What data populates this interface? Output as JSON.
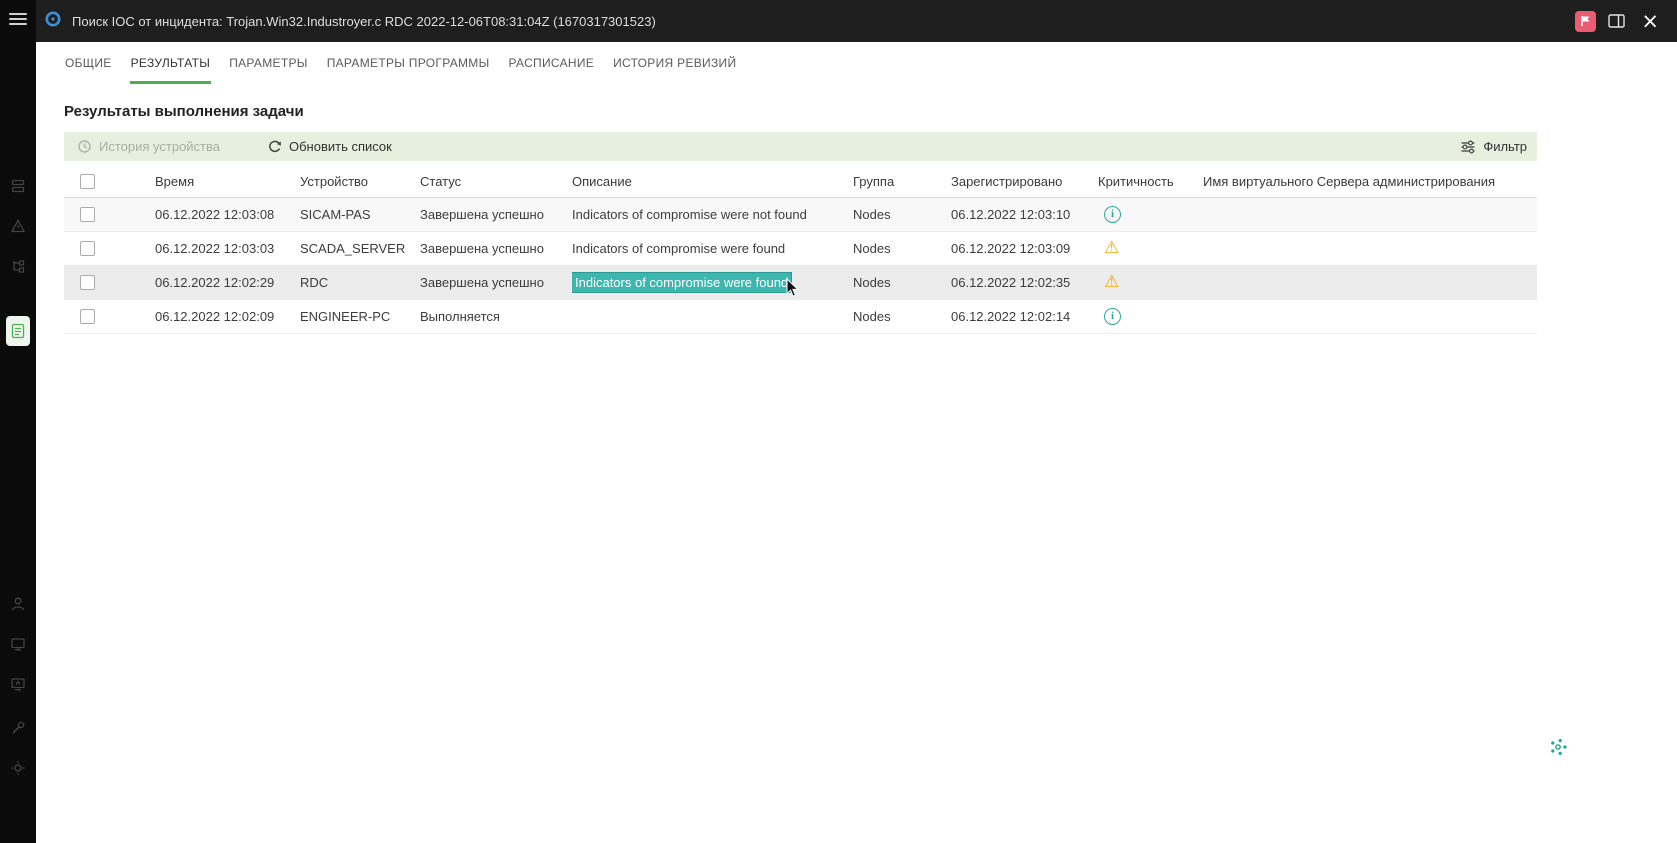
{
  "colors": {
    "accent_green": "#4caf50",
    "toolbar_band": "#e7f0de",
    "selection_teal": "#3db6af",
    "info_teal": "#2aa8a3",
    "warning_amber": "#f2a60a",
    "flag_pink": "#ea5c72",
    "titlebar_bg": "#1e1e1e",
    "sidebar_bg": "#0b0b0b"
  },
  "titlebar": {
    "title": "Поиск IOC от инцидента: Trojan.Win32.Industroyer.c RDC 2022-12-06T08:31:04Z (1670317301523)"
  },
  "tabs": [
    {
      "label": "ОБЩИЕ"
    },
    {
      "label": "РЕЗУЛЬТАТЫ"
    },
    {
      "label": "ПАРАМЕТРЫ"
    },
    {
      "label": "ПАРАМЕТРЫ ПРОГРАММЫ"
    },
    {
      "label": "РАСПИСАНИЕ"
    },
    {
      "label": "ИСТОРИЯ РЕВИЗИЙ"
    }
  ],
  "active_tab": "РЕЗУЛЬТАТЫ",
  "page": {
    "heading": "Результаты выполнения задачи"
  },
  "toolbar": {
    "device_history_label": "История устройства",
    "refresh_label": "Обновить список",
    "filter_label": "Фильтр"
  },
  "table": {
    "headers": [
      "Время",
      "Устройство",
      "Статус",
      "Описание",
      "Группа",
      "Зарегистрировано",
      "Критичность",
      "Имя виртуального Сервера администрирования"
    ],
    "rows": [
      {
        "time": "06.12.2022 12:03:08",
        "device": "SICAM-PAS",
        "status": "Завершена успешно",
        "description": "Indicators of compromise were not found",
        "group": "Nodes",
        "registered": "06.12.2022 12:03:10",
        "severity": "info"
      },
      {
        "time": "06.12.2022 12:03:03",
        "device": "SCADA_SERVER",
        "status": "Завершена успешно",
        "description": "Indicators of compromise were found",
        "group": "Nodes",
        "registered": "06.12.2022 12:03:09",
        "severity": "warning"
      },
      {
        "time": "06.12.2022 12:02:29",
        "device": "RDC",
        "status": "Завершена успешно",
        "description": "Indicators of compromise were found",
        "group": "Nodes",
        "registered": "06.12.2022 12:02:35",
        "severity": "warning",
        "selected": true,
        "description_selected": true
      },
      {
        "time": "06.12.2022 12:02:09",
        "device": "ENGINEER-PC",
        "status": "Выполняется",
        "description": "",
        "group": "Nodes",
        "registered": "06.12.2022 12:02:14",
        "severity": "info"
      }
    ]
  }
}
